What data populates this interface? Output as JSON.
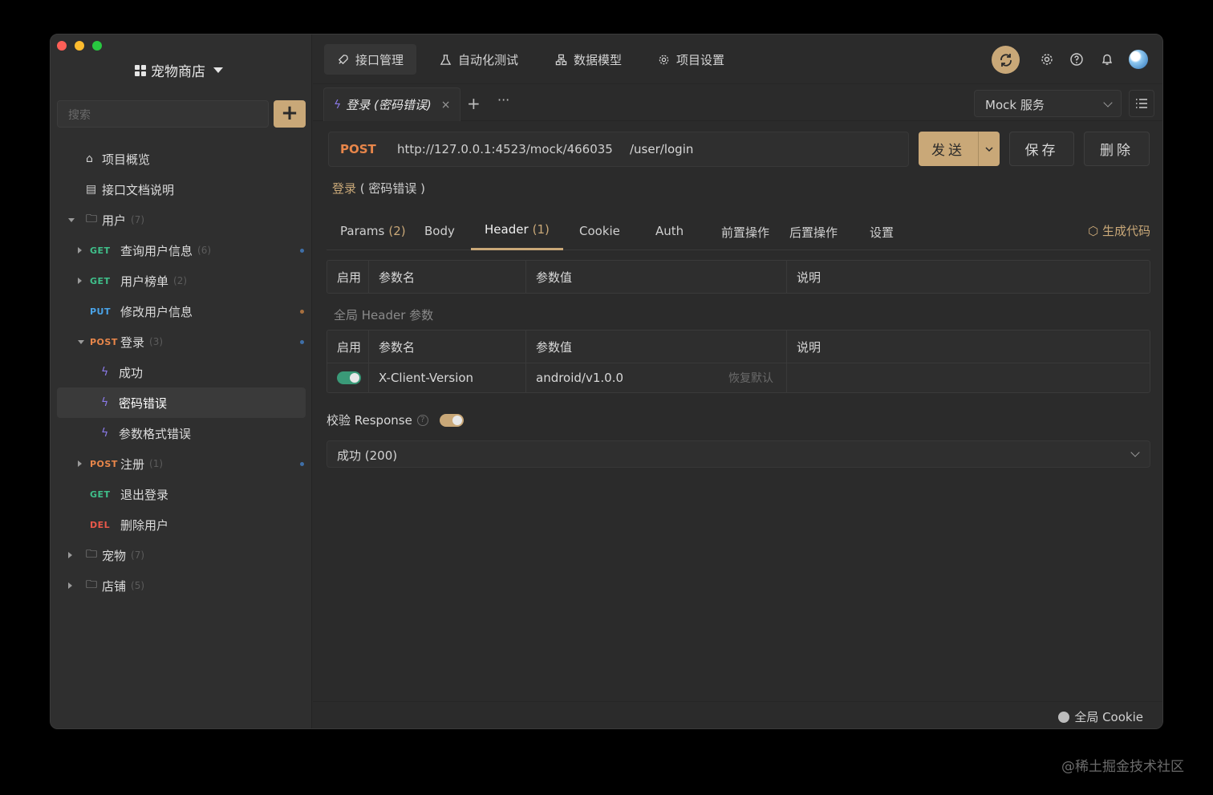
{
  "sidebar": {
    "project_name": "宠物商店",
    "search_placeholder": "搜索",
    "add_label": "+",
    "items": [
      {
        "kind": "page",
        "label": "项目概览",
        "icon": "bank-icon"
      },
      {
        "kind": "page",
        "label": "接口文档说明",
        "icon": "document-icon"
      },
      {
        "kind": "folder",
        "label": "用户",
        "count": "(7)",
        "expanded": true
      },
      {
        "kind": "api",
        "method": "GET",
        "label": "查询用户信息",
        "count": "(6)",
        "expandable": true,
        "dot": "#3f6fa8"
      },
      {
        "kind": "api",
        "method": "GET",
        "label": "用户榜单",
        "count": "(2)",
        "expandable": true
      },
      {
        "kind": "api",
        "method": "PUT",
        "label": "修改用户信息",
        "dot": "#a8703f"
      },
      {
        "kind": "api",
        "method": "POST",
        "label": "登录",
        "count": "(3)",
        "expanded": true,
        "dot": "#3f6fa8"
      },
      {
        "kind": "case",
        "label": "成功"
      },
      {
        "kind": "case",
        "label": "密码错误",
        "active": true
      },
      {
        "kind": "case",
        "label": "参数格式错误"
      },
      {
        "kind": "api",
        "method": "POST",
        "label": "注册",
        "count": "(1)",
        "expandable": true,
        "dot": "#3f6fa8"
      },
      {
        "kind": "api",
        "method": "GET",
        "label": "退出登录"
      },
      {
        "kind": "api",
        "method": "DEL",
        "label": "删除用户"
      },
      {
        "kind": "folder",
        "label": "宠物",
        "count": "(7)"
      },
      {
        "kind": "folder",
        "label": "店铺",
        "count": "(5)"
      }
    ]
  },
  "topnav": {
    "tabs": [
      {
        "label": "接口管理",
        "icon": "rocket-icon",
        "selected": true
      },
      {
        "label": "自动化测试",
        "icon": "flask-icon"
      },
      {
        "label": "数据模型",
        "icon": "model-icon"
      },
      {
        "label": "项目设置",
        "icon": "gear-icon"
      }
    ]
  },
  "tabbar": {
    "doc_tab": "登录 (密码错误)",
    "close": "×",
    "plus": "+",
    "more": "···",
    "env": "Mock 服务"
  },
  "request": {
    "method": "POST",
    "base_url": "http://127.0.0.1:4523/mock/466035",
    "path": "/user/login",
    "send": "发送",
    "save": "保存",
    "delete": "删除",
    "name_prefix": "登录",
    "name_suffix": "( 密码错误 )"
  },
  "param_tabs": [
    {
      "label": "Params",
      "count": "(2)"
    },
    {
      "label": "Body"
    },
    {
      "label": "Header",
      "count": "(1)",
      "selected": true
    },
    {
      "label": "Cookie"
    },
    {
      "label": "Auth"
    },
    {
      "label": "前置操作"
    },
    {
      "label": "后置操作"
    },
    {
      "label": "设置"
    }
  ],
  "gen_code": "生成代码",
  "table": {
    "headers": [
      "启用",
      "参数名",
      "参数值",
      "说明"
    ]
  },
  "global_header_label": "全局 Header 参数",
  "global_table": {
    "headers": [
      "启用",
      "参数名",
      "参数值",
      "说明"
    ],
    "rows": [
      {
        "enabled": true,
        "name": "X-Client-Version",
        "value": "android/v1.0.0",
        "restore": "恢复默认",
        "desc": ""
      }
    ]
  },
  "verify": {
    "label": "校验 Response",
    "help": "?",
    "enabled": true
  },
  "response_select": "成功 (200)",
  "footer": {
    "cookie": "全局 Cookie"
  },
  "watermark": "@稀土掘金技术社区",
  "colors": {
    "accent": "#c9a878",
    "toggle_green": "#3a9a78"
  }
}
